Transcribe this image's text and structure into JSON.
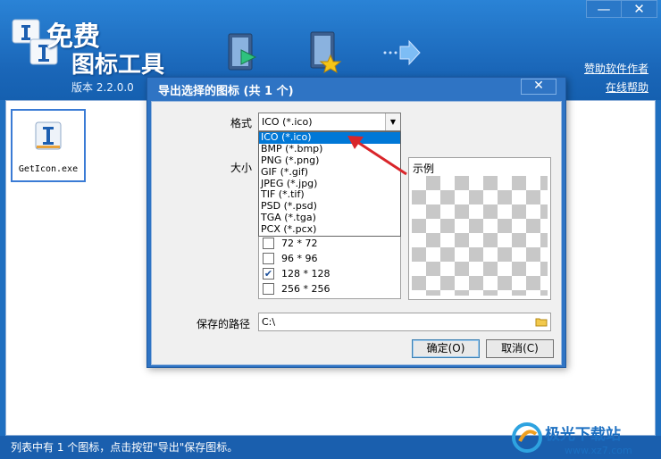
{
  "app": {
    "title_line1": "免费",
    "title_line2": "图标工具",
    "version": "版本 2.2.0.0",
    "window_controls": {
      "minimize": "—",
      "close": "✕"
    },
    "links": {
      "sponsor": "赞助软件作者",
      "help": "在线帮助"
    },
    "toolbar": [
      "open-icon",
      "favorite-icon",
      "export-icon"
    ]
  },
  "file_list": {
    "items": [
      {
        "label": "GetIcon.exe"
      }
    ]
  },
  "status_bar": {
    "text": "列表中有 1 个图标，点击按钮\"导出\"保存图标。"
  },
  "watermark": {
    "text": "极光下载站",
    "url_text": "www.xz7.com"
  },
  "dialog": {
    "title": "导出选择的图标 (共 1 个)",
    "close": "✕",
    "format_label": "格式",
    "format_value": "ICO (*.ico)",
    "format_options": [
      "ICO (*.ico)",
      "BMP (*.bmp)",
      "PNG (*.png)",
      "GIF (*.gif)",
      "JPEG (*.jpg)",
      "TIF (*.tif)",
      "PSD (*.psd)",
      "TGA (*.tga)",
      "PCX (*.pcx)"
    ],
    "size_label": "大小",
    "sizes": [
      {
        "label": "72 * 72",
        "checked": false
      },
      {
        "label": "96 * 96",
        "checked": false
      },
      {
        "label": "128 * 128",
        "checked": true
      },
      {
        "label": "256 * 256",
        "checked": false
      }
    ],
    "preview_label": "示例",
    "path_label": "保存的路径",
    "path_value": "C:\\",
    "ok_label": "确定(O)",
    "cancel_label": "取消(C)"
  },
  "colors": {
    "header_blue": "#1a66b8",
    "selection_blue": "#0078d7",
    "arrow_red": "#d9252a"
  }
}
